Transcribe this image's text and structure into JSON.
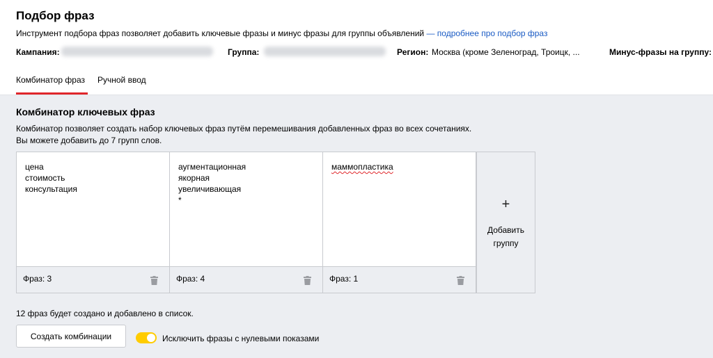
{
  "header": {
    "title": "Подбор фраз",
    "description": "Инструмент подбора фраз позволяет добавить ключевые фразы и минус фразы для группы объявлений",
    "more_link": "— подробнее про подбор фраз"
  },
  "meta": {
    "campaign_label": "Кампания:",
    "group_label": "Группа:",
    "region_label": "Регион:",
    "region_value": "Москва (кроме Зеленоград, Троицк, ...",
    "minus_label": "Минус-фразы на группу:"
  },
  "tabs": {
    "combinator": "Комбинатор фраз",
    "manual": "Ручной ввод"
  },
  "section": {
    "title": "Комбинатор ключевых фраз",
    "line1": "Комбинатор позволяет создать набор ключевых фраз путём перемешивания добавленных фраз во всех сочетаниях.",
    "line2": "Вы можете добавить до 7 групп слов."
  },
  "groups": [
    {
      "phrases": "цена\nстоимость\nконсультация",
      "count": "Фраз: 3"
    },
    {
      "phrases": "аугментационная\nякорная\nувеличивающая\n*",
      "count": "Фраз: 4"
    },
    {
      "phrases": "маммопластика",
      "count": "Фраз: 1"
    }
  ],
  "add_group": {
    "plus": "+",
    "label": "Добавить группу"
  },
  "summary": "12 фраз будет создано и добавлено в список.",
  "create_button": "Создать комбинации",
  "exclude_toggle": {
    "label": "Исключить фразы с нулевыми показами",
    "on": true
  },
  "colors": {
    "accent_red": "#e0262b",
    "link_blue": "#1a5bc4",
    "toggle_yellow": "#ffcc00"
  }
}
